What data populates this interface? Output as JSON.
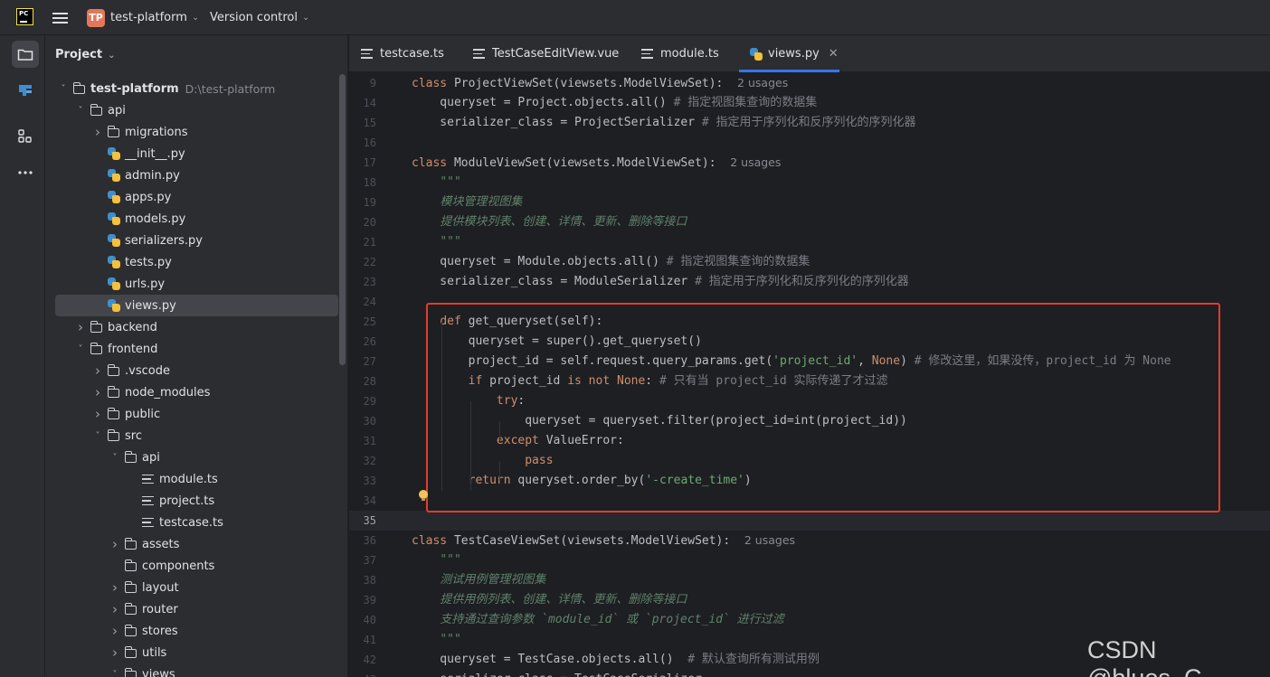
{
  "titlebar": {
    "project_initials": "TP",
    "project_name": "test-platform",
    "version_control": "Version control"
  },
  "project_panel": {
    "title": "Project",
    "tree": [
      {
        "label": "test-platform",
        "hint": "D:\\test-platform",
        "type": "folder",
        "expanded": true,
        "depth": 0,
        "bold": true
      },
      {
        "label": "api",
        "type": "folder",
        "expanded": true,
        "depth": 1
      },
      {
        "label": "migrations",
        "type": "folder",
        "expanded": false,
        "depth": 2
      },
      {
        "label": "__init__.py",
        "type": "py",
        "depth": 2
      },
      {
        "label": "admin.py",
        "type": "py",
        "depth": 2
      },
      {
        "label": "apps.py",
        "type": "py",
        "depth": 2
      },
      {
        "label": "models.py",
        "type": "py",
        "depth": 2
      },
      {
        "label": "serializers.py",
        "type": "py",
        "depth": 2
      },
      {
        "label": "tests.py",
        "type": "py",
        "depth": 2
      },
      {
        "label": "urls.py",
        "type": "py",
        "depth": 2
      },
      {
        "label": "views.py",
        "type": "py",
        "depth": 2,
        "selected": true
      },
      {
        "label": "backend",
        "type": "folder",
        "expanded": false,
        "depth": 1
      },
      {
        "label": "frontend",
        "type": "folder",
        "expanded": true,
        "depth": 1
      },
      {
        "label": ".vscode",
        "type": "folder",
        "expanded": false,
        "depth": 2
      },
      {
        "label": "node_modules",
        "type": "folder",
        "expanded": false,
        "depth": 2
      },
      {
        "label": "public",
        "type": "folder",
        "expanded": false,
        "depth": 2
      },
      {
        "label": "src",
        "type": "folder",
        "expanded": true,
        "depth": 2
      },
      {
        "label": "api",
        "type": "folder",
        "expanded": true,
        "depth": 3
      },
      {
        "label": "module.ts",
        "type": "ts",
        "depth": 4
      },
      {
        "label": "project.ts",
        "type": "ts",
        "depth": 4
      },
      {
        "label": "testcase.ts",
        "type": "ts",
        "depth": 4
      },
      {
        "label": "assets",
        "type": "folder",
        "expanded": false,
        "depth": 3
      },
      {
        "label": "components",
        "type": "folder",
        "depth": 3
      },
      {
        "label": "layout",
        "type": "folder",
        "expanded": false,
        "depth": 3
      },
      {
        "label": "router",
        "type": "folder",
        "expanded": false,
        "depth": 3
      },
      {
        "label": "stores",
        "type": "folder",
        "expanded": false,
        "depth": 3
      },
      {
        "label": "utils",
        "type": "folder",
        "expanded": false,
        "depth": 3
      },
      {
        "label": "views",
        "type": "folder",
        "expanded": true,
        "depth": 3
      }
    ]
  },
  "tabs": [
    {
      "label": "testcase.ts",
      "icon": "ts-file-icon"
    },
    {
      "label": "TestCaseEditView.vue",
      "icon": "vue-file-icon"
    },
    {
      "label": "module.ts",
      "icon": "ts-file-icon"
    },
    {
      "label": "views.py",
      "icon": "python-file-icon",
      "active": true
    }
  ],
  "editor": {
    "current_line": "35",
    "lines": [
      {
        "n": "9",
        "html": "<span class=\"kw\">class</span> ProjectViewSet(viewsets.ModelViewSet):  <span class=\"usages\">2 usages</span>"
      },
      {
        "n": "14",
        "html": "    queryset = Project.objects.all() <span class=\"cmt\"># 指定视图集查询的数据集</span>"
      },
      {
        "n": "15",
        "html": "    serializer_class = ProjectSerializer <span class=\"cmt\"># 指定用于序列化和反序列化的序列化器</span>"
      },
      {
        "n": "16",
        "html": ""
      },
      {
        "n": "17",
        "html": "<span class=\"kw\">class</span> ModuleViewSet(viewsets.ModelViewSet):  <span class=\"usages\">2 usages</span>"
      },
      {
        "n": "18",
        "html": "    <span class=\"doc\">\"\"\"</span>"
      },
      {
        "n": "19",
        "html": "    <span class=\"doc\">模块管理视图集</span>"
      },
      {
        "n": "20",
        "html": "    <span class=\"doc\">提供模块列表、创建、详情、更新、删除等接口</span>"
      },
      {
        "n": "21",
        "html": "    <span class=\"doc\">\"\"\"</span>"
      },
      {
        "n": "22",
        "html": "    queryset = Module.objects.all() <span class=\"cmt\"># 指定视图集查询的数据集</span>"
      },
      {
        "n": "23",
        "html": "    serializer_class = ModuleSerializer <span class=\"cmt\"># 指定用于序列化和反序列化的序列化器</span>"
      },
      {
        "n": "24",
        "html": ""
      },
      {
        "n": "25",
        "html": "    <span class=\"kw\">def</span> get_queryset(self):"
      },
      {
        "n": "26",
        "html": "        queryset = super().get_queryset()"
      },
      {
        "n": "27",
        "html": "        project_id = self.request.query_params.get(<span class=\"str\">'project_id'</span>, <span class=\"kw\">None</span>) <span class=\"cmt\"># 修改这里，如果没传，project_id 为 None</span>"
      },
      {
        "n": "28",
        "html": "        <span class=\"kw\">if</span> project_id <span class=\"kw\">is not None</span>: <span class=\"cmt\"># 只有当 project_id 实际传递了才过滤</span>"
      },
      {
        "n": "29",
        "html": "            <span class=\"kw\">try</span>:"
      },
      {
        "n": "30",
        "html": "                queryset = queryset.filter(project_id=int(project_id))"
      },
      {
        "n": "31",
        "html": "            <span class=\"kw\">except</span> ValueError:"
      },
      {
        "n": "32",
        "html": "                <span class=\"kw\">pass</span>"
      },
      {
        "n": "33",
        "html": "        <span class=\"kw\">return</span> queryset.order_by(<span class=\"str\">'-create_time'</span>)"
      },
      {
        "n": "34",
        "html": ""
      },
      {
        "n": "35",
        "html": ""
      },
      {
        "n": "36",
        "html": "<span class=\"kw\">class</span> TestCaseViewSet(viewsets.ModelViewSet):  <span class=\"usages\">2 usages</span>"
      },
      {
        "n": "37",
        "html": "    <span class=\"doc\">\"\"\"</span>"
      },
      {
        "n": "38",
        "html": "    <span class=\"doc\">测试用例管理视图集</span>"
      },
      {
        "n": "39",
        "html": "    <span class=\"doc\">提供用例列表、创建、详情、更新、删除等接口</span>"
      },
      {
        "n": "40",
        "html": "    <span class=\"doc\">支持通过查询参数 `module_id` 或 `project_id` 进行过滤</span>"
      },
      {
        "n": "41",
        "html": "    <span class=\"doc\">\"\"\"</span>"
      },
      {
        "n": "42",
        "html": "    queryset = TestCase.objects.all()  <span class=\"cmt\"># 默认查询所有测试用例</span>"
      },
      {
        "n": "43",
        "html": "    serializer_class = TestCaseSerializer"
      }
    ]
  },
  "watermark": "CSDN @blues_C",
  "colors": {
    "accent": "#3574f0",
    "highlight_box": "#e23b2e",
    "keyword": "#cf8e6d",
    "string": "#6aab73"
  }
}
